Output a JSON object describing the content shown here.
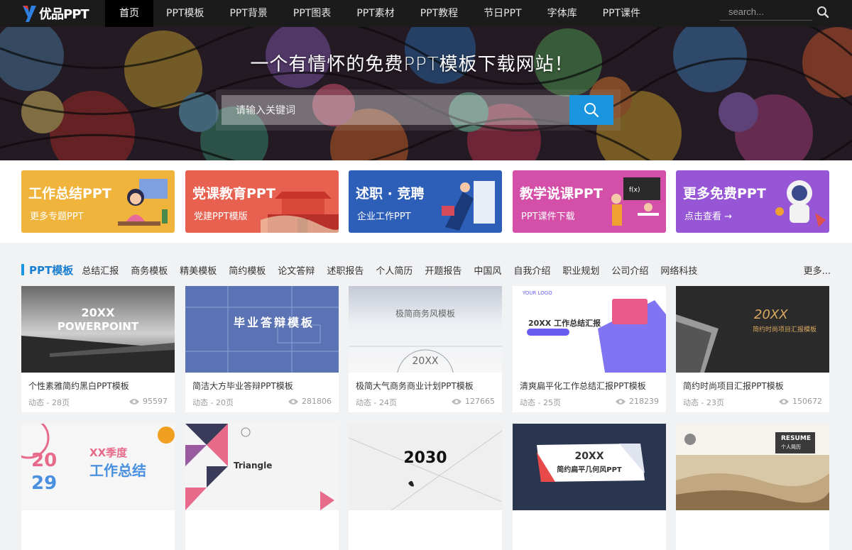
{
  "nav": {
    "logo_text": "优品PPT",
    "items": [
      {
        "label": "首页"
      },
      {
        "label": "PPT模板"
      },
      {
        "label": "PPT背景"
      },
      {
        "label": "PPT图表"
      },
      {
        "label": "PPT素材"
      },
      {
        "label": "PPT教程"
      },
      {
        "label": "节日PPT"
      },
      {
        "label": "字体库"
      },
      {
        "label": "PPT课件"
      }
    ],
    "search_placeholder": "search..."
  },
  "hero": {
    "slogan": "一个有情怀的免费PPT模板下载网站！",
    "search_placeholder": "请输入关键词",
    "accent": "#1a96e0"
  },
  "banners": [
    {
      "title": "工作总结PPT",
      "subtitle": "更多专题PPT",
      "color": "#f0b43c"
    },
    {
      "title": "党课教育PPT",
      "subtitle": "党建PPT模版",
      "color": "#e8604f"
    },
    {
      "title": "述职 · 竞聘",
      "subtitle": "企业工作PPT",
      "color": "#2d5fb8"
    },
    {
      "title": "教学说课PPT",
      "subtitle": "PPT课件下载",
      "color": "#d44fa8"
    },
    {
      "title": "更多免费PPT",
      "subtitle": "点击查看 →",
      "color": "#9656d6"
    }
  ],
  "section": {
    "title": "PPT模板",
    "categories": [
      "总结汇报",
      "商务模板",
      "精美模板",
      "简约模板",
      "论文答辩",
      "述职报告",
      "个人简历",
      "开题报告",
      "中国风",
      "自我介绍",
      "职业规划",
      "公司介绍",
      "网络科技"
    ],
    "more": "更多..."
  },
  "cards": [
    {
      "name": "个性素雅简约黑白PPT模板",
      "meta": "动态 - 28页",
      "views": "95597",
      "thumb_text": "20XX",
      "thumb_sub": "POWERPOINT"
    },
    {
      "name": "简洁大方毕业答辩PPT模板",
      "meta": "动态 - 20页",
      "views": "281806",
      "thumb_text": "毕业答辩模板"
    },
    {
      "name": "极简大气商务商业计划PPT模板",
      "meta": "动态 - 24页",
      "views": "127665",
      "thumb_text": "极简商务风模板",
      "thumb_sub": "20XX"
    },
    {
      "name": "清爽扁平化工作总结汇报PPT模板",
      "meta": "动态 - 25页",
      "views": "218239",
      "thumb_text": "20XX 工作总结汇报",
      "thumb_sub": "YOUR LOGO"
    },
    {
      "name": "简约时尚项目汇报PPT模板",
      "meta": "动态 - 23页",
      "views": "150672",
      "thumb_text": "20XX",
      "thumb_sub": "简约时尚项目汇报模板"
    },
    {
      "thumb_text": "XX季度",
      "thumb_sub": "工作总结"
    },
    {
      "thumb_text": "Triangle"
    },
    {
      "thumb_text": "2030"
    },
    {
      "thumb_text": "20XX",
      "thumb_sub": "简约扁平几何风PPT"
    },
    {
      "thumb_text": "RESUME",
      "thumb_sub": "个人简历"
    }
  ]
}
